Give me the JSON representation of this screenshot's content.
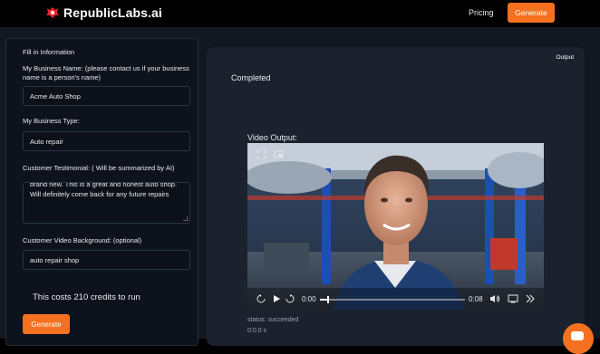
{
  "header": {
    "brand": "RepublicLabs.ai",
    "nav_pricing": "Pricing",
    "nav_generate": "Generate"
  },
  "form": {
    "title": "Fill in Information",
    "business_name_label": "My Business Name: (please contact us if your business name is a person's name)",
    "business_name_value": "Acme Auto Shop",
    "business_type_label": "My Business Type:",
    "business_type_value": "Auto repair",
    "testimonial_label": "Customer Testimonial: ( Will be summarized by AI)",
    "testimonial_value": "brand new. This is a great and honest auto shop. Will definitely come back for any future repairs",
    "background_label": "Customer Video Background: (optional)",
    "background_value": "auto repair shop",
    "cost_text": "This costs 210 credits to run",
    "generate_label": "Generate"
  },
  "output": {
    "tag": "Output",
    "state": "Completed",
    "video_label": "Video Output:",
    "current_time": "0:00",
    "duration": "0:08",
    "progress": 0.05,
    "status": "status: succeeded",
    "timing": "0:0.0 s"
  },
  "colors": {
    "accent": "#f5711f",
    "panel_bg": "#0d131d",
    "output_bg": "#1b222d"
  },
  "icons": [
    "logo-icon",
    "fullscreen-icon",
    "pip-icon",
    "replay-back-icon",
    "play-icon",
    "forward-icon",
    "volume-icon",
    "cast-icon",
    "more-icon",
    "chat-icon"
  ]
}
